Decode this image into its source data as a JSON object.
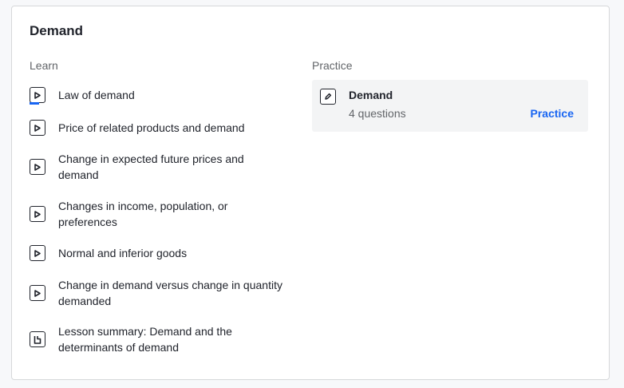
{
  "unit": {
    "title": "Demand",
    "learn_heading": "Learn",
    "practice_heading": "Practice"
  },
  "lessons": [
    {
      "label": "Law of demand",
      "icon": "video-play-icon",
      "in_progress": true
    },
    {
      "label": "Price of related products and demand",
      "icon": "video-play-icon"
    },
    {
      "label": "Change in expected future prices and demand",
      "icon": "video-play-icon"
    },
    {
      "label": "Changes in income, population, or preferences",
      "icon": "video-play-icon"
    },
    {
      "label": "Normal and inferior goods",
      "icon": "video-play-icon"
    },
    {
      "label": "Change in demand versus change in quantity demanded",
      "icon": "video-play-icon"
    },
    {
      "label": "Lesson summary: Demand and the determinants of demand",
      "icon": "article-icon"
    }
  ],
  "practice": {
    "title": "Demand",
    "subtitle": "4 questions",
    "action_label": "Practice",
    "icon": "pencil-icon"
  },
  "colors": {
    "accent": "#1865f2",
    "text": "#21242c",
    "muted": "#626569",
    "practice_bg": "#f3f4f5"
  }
}
